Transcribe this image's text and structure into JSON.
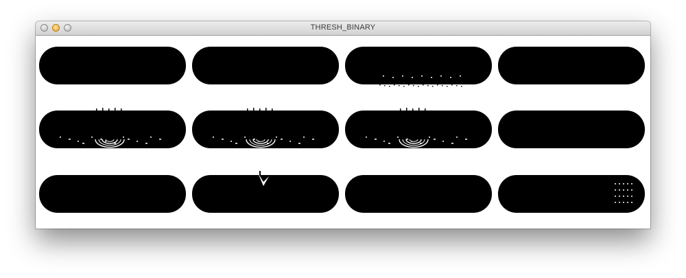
{
  "window": {
    "title": "THRESH_BINARY",
    "controls": [
      "close-icon",
      "minimize-icon",
      "zoom-icon"
    ]
  },
  "image": {
    "description_free": true,
    "grid": {
      "rows": 3,
      "cols": 4
    },
    "colors": {
      "foreground": "#000000",
      "background": "#ffffff"
    },
    "cells": [
      {
        "row": 1,
        "col": 1,
        "artifact": "none"
      },
      {
        "row": 1,
        "col": 2,
        "artifact": "none"
      },
      {
        "row": 1,
        "col": 3,
        "artifact": "speckle-bottom"
      },
      {
        "row": 1,
        "col": 4,
        "artifact": "none"
      },
      {
        "row": 2,
        "col": 1,
        "artifact": "arcs"
      },
      {
        "row": 2,
        "col": 2,
        "artifact": "arcs"
      },
      {
        "row": 2,
        "col": 3,
        "artifact": "arcs"
      },
      {
        "row": 2,
        "col": 4,
        "artifact": "none"
      },
      {
        "row": 3,
        "col": 1,
        "artifact": "none"
      },
      {
        "row": 3,
        "col": 2,
        "artifact": "notch-top"
      },
      {
        "row": 3,
        "col": 3,
        "artifact": "none"
      },
      {
        "row": 3,
        "col": 4,
        "artifact": "speckle-right"
      }
    ]
  }
}
